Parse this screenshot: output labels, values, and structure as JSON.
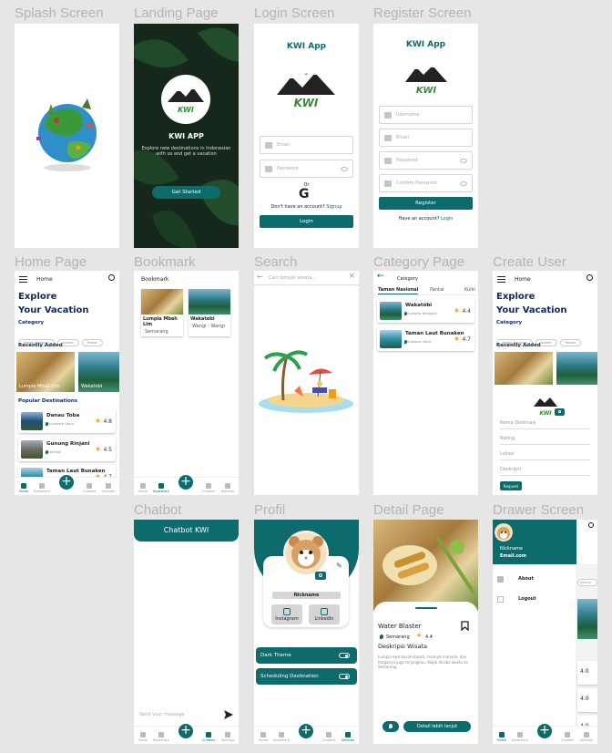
{
  "colors": {
    "primary": "#0e6b6b",
    "star": "#f5a623",
    "canvas": "#e6e6e6"
  },
  "labels": {
    "splash": "Splash Screen",
    "landing": "Landing Page",
    "login": "Login Screen",
    "register": "Register Screen",
    "home": "Home Page",
    "bookmark": "Bookmark",
    "search": "Search",
    "category": "Category Page",
    "create_user": "Create User",
    "chatbot": "Chatbot",
    "profil": "Profil",
    "detail": "Detail Page",
    "drawer": "Drawer Screen"
  },
  "landing": {
    "logo_text": "KWI",
    "title": "KWI APP",
    "subtitle": "Explore new destinations in Indonesian with us and get a vacation",
    "button": "Get Started"
  },
  "login": {
    "title": "KWI App",
    "logo_text": "KWI",
    "email_placeholder": "Email",
    "password_placeholder": "Password",
    "or": "Or",
    "google": "G",
    "signup_prompt": "Don't have an account?",
    "signup_link": "Signup",
    "button": "Login"
  },
  "register": {
    "title": "KWI App",
    "logo_text": "KWI",
    "username_placeholder": "Username",
    "email_placeholder": "Email",
    "password_placeholder": "Password",
    "confirm_placeholder": "Confirm Password",
    "button": "Register",
    "login_prompt": "Have an account?",
    "login_link": "Login"
  },
  "home": {
    "header": "Home",
    "headline1": "Explore",
    "headline2": "Your Vacation",
    "category_title": "Category",
    "chips": [
      "Taman Nasional",
      "Kuliner",
      "Pantai"
    ],
    "recent_title": "Recently Added",
    "recent": [
      {
        "name": "Lumpia Mbah Lim",
        "image": "food"
      },
      {
        "name": "Wakatobi",
        "image": "sea"
      }
    ],
    "popular_title": "Popular Destinations",
    "popular": [
      {
        "name": "Danau Toba",
        "location": "Sumatera Utara",
        "rating": "4.8",
        "image": "lake"
      },
      {
        "name": "Gunung Rinjani",
        "location": "Lombok",
        "rating": "4.5",
        "image": "mount"
      },
      {
        "name": "Taman Laut Bunaken",
        "location": "Sulawesi",
        "rating": "4.7",
        "image": "island"
      }
    ],
    "nav": [
      "Home",
      "Bookmark",
      "",
      "Chatbot",
      "Settings"
    ]
  },
  "bookmark": {
    "header": "Bookmark",
    "items": [
      {
        "name": "Lumpia Mbah Lim",
        "location": "Semarang",
        "image": "food"
      },
      {
        "name": "Wakatobi",
        "location": "Wangi - Wangi",
        "image": "sea"
      }
    ],
    "nav": [
      "Home",
      "Bookmark",
      "",
      "Chatbot",
      "Settings"
    ]
  },
  "search": {
    "placeholder": "Cari tempat wisata...",
    "clear": "×"
  },
  "category": {
    "header": "Category",
    "tabs": [
      "Taman Nasional",
      "Pantai",
      "Kulin"
    ],
    "items": [
      {
        "name": "Wakatobi",
        "location": "Sulawesi Tenggara",
        "rating": "4.4",
        "image": "sea"
      },
      {
        "name": "Taman Laut Bunaken",
        "location": "Sulawesi Utara",
        "rating": "4.7",
        "image": "island"
      }
    ]
  },
  "create_user": {
    "header": "Home",
    "headline1": "Explore",
    "headline2": "Your Vacation",
    "category_title": "Category",
    "chips": [
      "Taman Nasional",
      "Kuliner",
      "Pantai"
    ],
    "recent_title": "Recently Added",
    "logo_text": "KWI",
    "fields": [
      "Nama Destinasi",
      "Rating",
      "Lokasi",
      "Deskripsi"
    ],
    "button": "Request"
  },
  "chatbot": {
    "header": "Chatbot KWI",
    "input_placeholder": "Send your message",
    "nav": [
      "Home",
      "Bookmark",
      "",
      "Chatbot",
      "Settings"
    ]
  },
  "profil": {
    "nickname": "Nickname",
    "buttons": [
      "Instagram",
      "LinkedIn"
    ],
    "settings": [
      "Dark Theme",
      "Scheduling Destination"
    ],
    "nav": [
      "Home",
      "Bookmark",
      "",
      "Chatbot",
      "Settings"
    ]
  },
  "detail": {
    "title": "Water Blaster",
    "location": "Semarang",
    "rating": "4.4",
    "desc_title": "Deskripsi Wisata",
    "desc": "Lumpia ewe basah-basah, rasanya menarik, dan harganya juga terjangkau. Wajib dicoba waktu ke Semarang.",
    "button": "Detail lebih lanjut"
  },
  "drawer": {
    "nickname": "Nickname",
    "email": "Email.com",
    "menu": [
      "About",
      "Logout"
    ],
    "ratings": [
      "4.0",
      "4.0",
      "4.0"
    ],
    "chip": "Kuliner",
    "nav": [
      "Home",
      "Bookmark",
      "",
      "Chatbot",
      "Settings"
    ]
  }
}
